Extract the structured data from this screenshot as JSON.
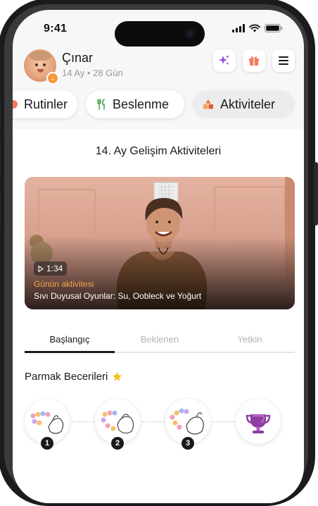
{
  "status_bar": {
    "time": "9:41"
  },
  "profile": {
    "name": "Çınar",
    "age": "14 Ay • 28 Gün"
  },
  "header_buttons": [
    {
      "icon": "sparkle-icon"
    },
    {
      "icon": "gift-icon"
    },
    {
      "icon": "menu-icon"
    }
  ],
  "tabs": [
    {
      "label": "Rutinler",
      "icon": "routine-icon"
    },
    {
      "label": "Beslenme",
      "icon": "fork-knife-icon"
    },
    {
      "label": "Aktiviteler",
      "icon": "shapes-icon",
      "active": true
    }
  ],
  "section": {
    "title": "14. Ay Gelişim Aktiviteleri"
  },
  "video": {
    "duration": "1:34",
    "label": "Günün aktivitesi",
    "title": "Sıvı Duyusal Oyunlar: Su, Oobleck ve Yoğurt"
  },
  "levels": {
    "items": [
      "Başlangıç",
      "Beklenen",
      "Yetkin"
    ],
    "active": "Başlangıç"
  },
  "skills": {
    "title": "Parmak Becerileri",
    "steps": [
      "1",
      "2",
      "3"
    ],
    "final_icon": "trophy-icon"
  },
  "colors": {
    "accent_orange": "#f3a44d",
    "trophy_purple": "#8e3fa3",
    "text": "#1a1a1a"
  }
}
